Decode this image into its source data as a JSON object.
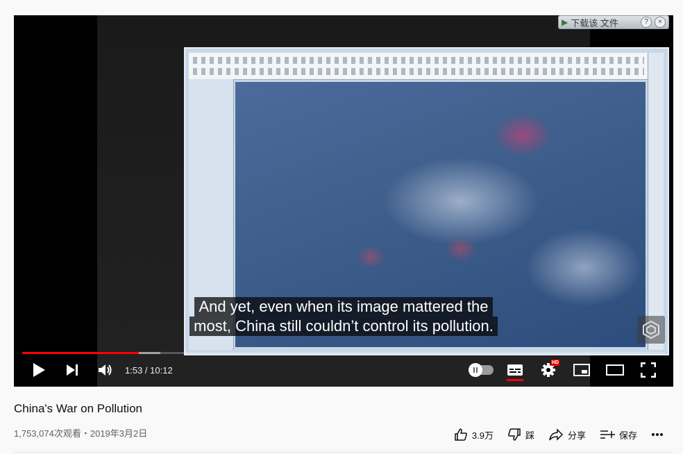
{
  "player": {
    "pip_badge_label": "下载该 文件",
    "pip_help": "?",
    "pip_close": "×",
    "subtitle_lines": [
      "And yet, even when its image mattered the",
      "most, China still couldn’t control its pollution."
    ],
    "progress_fraction": 0.181,
    "buffered_fraction": 0.215,
    "time": "1:53 / 10:12",
    "autoplay_on": false,
    "captions_on": true,
    "hd_label": "HD"
  },
  "video": {
    "title": "China's War on Pollution",
    "views_date": "1,753,074次观看・2019年3月2日"
  },
  "actions": {
    "like_count": "3.9万",
    "dislike_label": "踩",
    "share_label": "分享",
    "save_label": "保存"
  },
  "icons": [
    "play-icon",
    "next-icon",
    "volume-icon",
    "autoplay-toggle-icon",
    "subtitles-icon",
    "settings-icon",
    "miniplayer-icon",
    "theater-icon",
    "fullscreen-icon",
    "like-icon",
    "dislike-icon",
    "share-icon",
    "save-playlist-icon",
    "more-icon",
    "channel-watermark-icon"
  ],
  "colors": {
    "progress_played": "#ff0000",
    "player_bg": "#000000",
    "page_bg": "#f9f9f9"
  }
}
